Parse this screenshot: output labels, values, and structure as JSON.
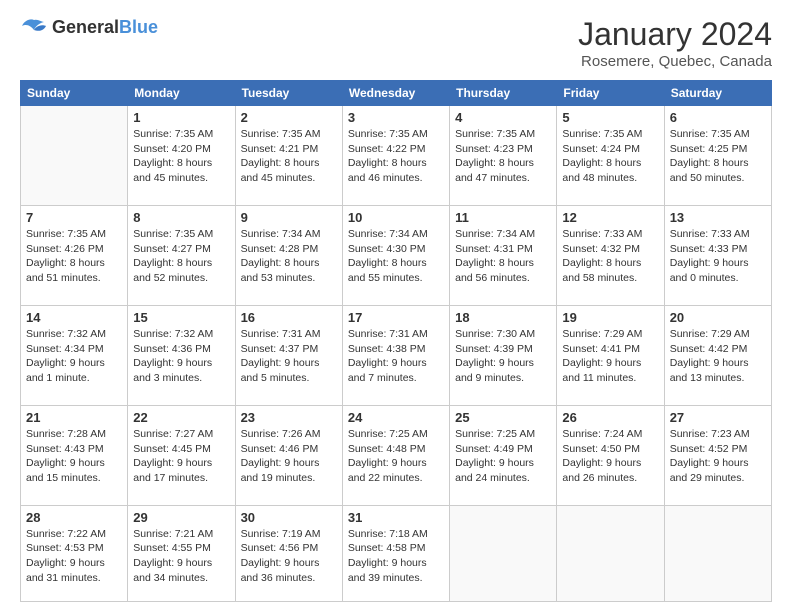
{
  "logo": {
    "general": "General",
    "blue": "Blue"
  },
  "header": {
    "month": "January 2024",
    "location": "Rosemere, Quebec, Canada"
  },
  "weekdays": [
    "Sunday",
    "Monday",
    "Tuesday",
    "Wednesday",
    "Thursday",
    "Friday",
    "Saturday"
  ],
  "weeks": [
    [
      {
        "day": "",
        "info": ""
      },
      {
        "day": "1",
        "info": "Sunrise: 7:35 AM\nSunset: 4:20 PM\nDaylight: 8 hours\nand 45 minutes."
      },
      {
        "day": "2",
        "info": "Sunrise: 7:35 AM\nSunset: 4:21 PM\nDaylight: 8 hours\nand 45 minutes."
      },
      {
        "day": "3",
        "info": "Sunrise: 7:35 AM\nSunset: 4:22 PM\nDaylight: 8 hours\nand 46 minutes."
      },
      {
        "day": "4",
        "info": "Sunrise: 7:35 AM\nSunset: 4:23 PM\nDaylight: 8 hours\nand 47 minutes."
      },
      {
        "day": "5",
        "info": "Sunrise: 7:35 AM\nSunset: 4:24 PM\nDaylight: 8 hours\nand 48 minutes."
      },
      {
        "day": "6",
        "info": "Sunrise: 7:35 AM\nSunset: 4:25 PM\nDaylight: 8 hours\nand 50 minutes."
      }
    ],
    [
      {
        "day": "7",
        "info": "Sunrise: 7:35 AM\nSunset: 4:26 PM\nDaylight: 8 hours\nand 51 minutes."
      },
      {
        "day": "8",
        "info": "Sunrise: 7:35 AM\nSunset: 4:27 PM\nDaylight: 8 hours\nand 52 minutes."
      },
      {
        "day": "9",
        "info": "Sunrise: 7:34 AM\nSunset: 4:28 PM\nDaylight: 8 hours\nand 53 minutes."
      },
      {
        "day": "10",
        "info": "Sunrise: 7:34 AM\nSunset: 4:30 PM\nDaylight: 8 hours\nand 55 minutes."
      },
      {
        "day": "11",
        "info": "Sunrise: 7:34 AM\nSunset: 4:31 PM\nDaylight: 8 hours\nand 56 minutes."
      },
      {
        "day": "12",
        "info": "Sunrise: 7:33 AM\nSunset: 4:32 PM\nDaylight: 8 hours\nand 58 minutes."
      },
      {
        "day": "13",
        "info": "Sunrise: 7:33 AM\nSunset: 4:33 PM\nDaylight: 9 hours\nand 0 minutes."
      }
    ],
    [
      {
        "day": "14",
        "info": "Sunrise: 7:32 AM\nSunset: 4:34 PM\nDaylight: 9 hours\nand 1 minute."
      },
      {
        "day": "15",
        "info": "Sunrise: 7:32 AM\nSunset: 4:36 PM\nDaylight: 9 hours\nand 3 minutes."
      },
      {
        "day": "16",
        "info": "Sunrise: 7:31 AM\nSunset: 4:37 PM\nDaylight: 9 hours\nand 5 minutes."
      },
      {
        "day": "17",
        "info": "Sunrise: 7:31 AM\nSunset: 4:38 PM\nDaylight: 9 hours\nand 7 minutes."
      },
      {
        "day": "18",
        "info": "Sunrise: 7:30 AM\nSunset: 4:39 PM\nDaylight: 9 hours\nand 9 minutes."
      },
      {
        "day": "19",
        "info": "Sunrise: 7:29 AM\nSunset: 4:41 PM\nDaylight: 9 hours\nand 11 minutes."
      },
      {
        "day": "20",
        "info": "Sunrise: 7:29 AM\nSunset: 4:42 PM\nDaylight: 9 hours\nand 13 minutes."
      }
    ],
    [
      {
        "day": "21",
        "info": "Sunrise: 7:28 AM\nSunset: 4:43 PM\nDaylight: 9 hours\nand 15 minutes."
      },
      {
        "day": "22",
        "info": "Sunrise: 7:27 AM\nSunset: 4:45 PM\nDaylight: 9 hours\nand 17 minutes."
      },
      {
        "day": "23",
        "info": "Sunrise: 7:26 AM\nSunset: 4:46 PM\nDaylight: 9 hours\nand 19 minutes."
      },
      {
        "day": "24",
        "info": "Sunrise: 7:25 AM\nSunset: 4:48 PM\nDaylight: 9 hours\nand 22 minutes."
      },
      {
        "day": "25",
        "info": "Sunrise: 7:25 AM\nSunset: 4:49 PM\nDaylight: 9 hours\nand 24 minutes."
      },
      {
        "day": "26",
        "info": "Sunrise: 7:24 AM\nSunset: 4:50 PM\nDaylight: 9 hours\nand 26 minutes."
      },
      {
        "day": "27",
        "info": "Sunrise: 7:23 AM\nSunset: 4:52 PM\nDaylight: 9 hours\nand 29 minutes."
      }
    ],
    [
      {
        "day": "28",
        "info": "Sunrise: 7:22 AM\nSunset: 4:53 PM\nDaylight: 9 hours\nand 31 minutes."
      },
      {
        "day": "29",
        "info": "Sunrise: 7:21 AM\nSunset: 4:55 PM\nDaylight: 9 hours\nand 34 minutes."
      },
      {
        "day": "30",
        "info": "Sunrise: 7:19 AM\nSunset: 4:56 PM\nDaylight: 9 hours\nand 36 minutes."
      },
      {
        "day": "31",
        "info": "Sunrise: 7:18 AM\nSunset: 4:58 PM\nDaylight: 9 hours\nand 39 minutes."
      },
      {
        "day": "",
        "info": ""
      },
      {
        "day": "",
        "info": ""
      },
      {
        "day": "",
        "info": ""
      }
    ]
  ]
}
